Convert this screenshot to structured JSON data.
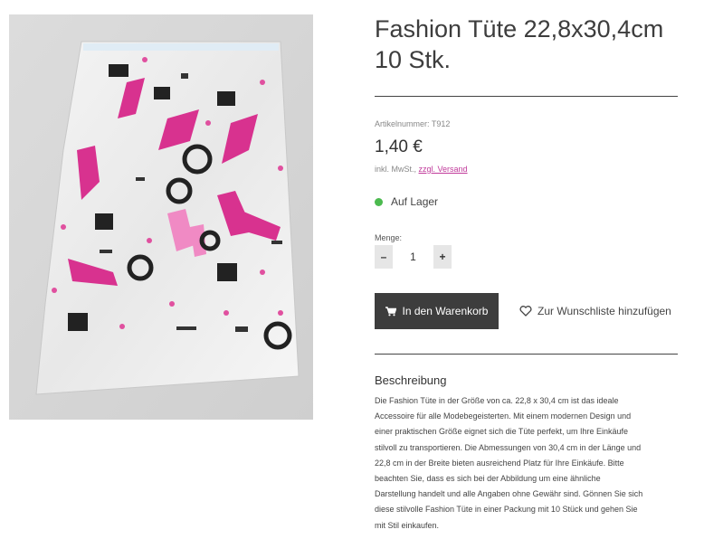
{
  "product": {
    "title_line1": "Fashion Tüte 22,8x30,4cm",
    "title_line2": "10 Stk.",
    "sku": "Artikelnummer: T912",
    "price": "1,40 €",
    "tax_prefix": "inkl. MwSt.,",
    "tax_link": "zzgl. Versand",
    "stock": "Auf Lager",
    "quantity_label": "Menge:",
    "quantity_value": "1",
    "decrement": "–",
    "increment": "+"
  },
  "actions": {
    "add_to_cart": "In den Warenkorb",
    "wishlist": "Zur Wunschliste hinzufügen"
  },
  "description": {
    "heading": "Beschreibung",
    "lines": [
      "Die Fashion Tüte in der Größe von ca. 22,8 x 30,4 cm ist das ideale",
      "Accessoire für alle Modebegeisterten. Mit einem modernen Design und",
      "einer praktischen Größe eignet sich die Tüte perfekt, um Ihre Einkäufe",
      "stilvoll zu transportieren. Die Abmessungen von 30,4 cm in der Länge und",
      "22,8 cm in der Breite bieten ausreichend Platz für Ihre Einkäufe. Bitte",
      "beachten Sie, dass es sich bei der Abbildung um eine ähnliche",
      "Darstellung handelt und alle Angaben ohne Gewähr sind. Gönnen Sie sich",
      "diese stilvolle Fashion Tüte in einer Packung mit 10 Stück und gehen Sie",
      "mit Stil einkaufen."
    ]
  },
  "colors": {
    "stock_green": "#4cba4f",
    "link_pink": "#c0399a",
    "button_dark": "#3d3d3d",
    "print_pink": "#d8328f"
  }
}
